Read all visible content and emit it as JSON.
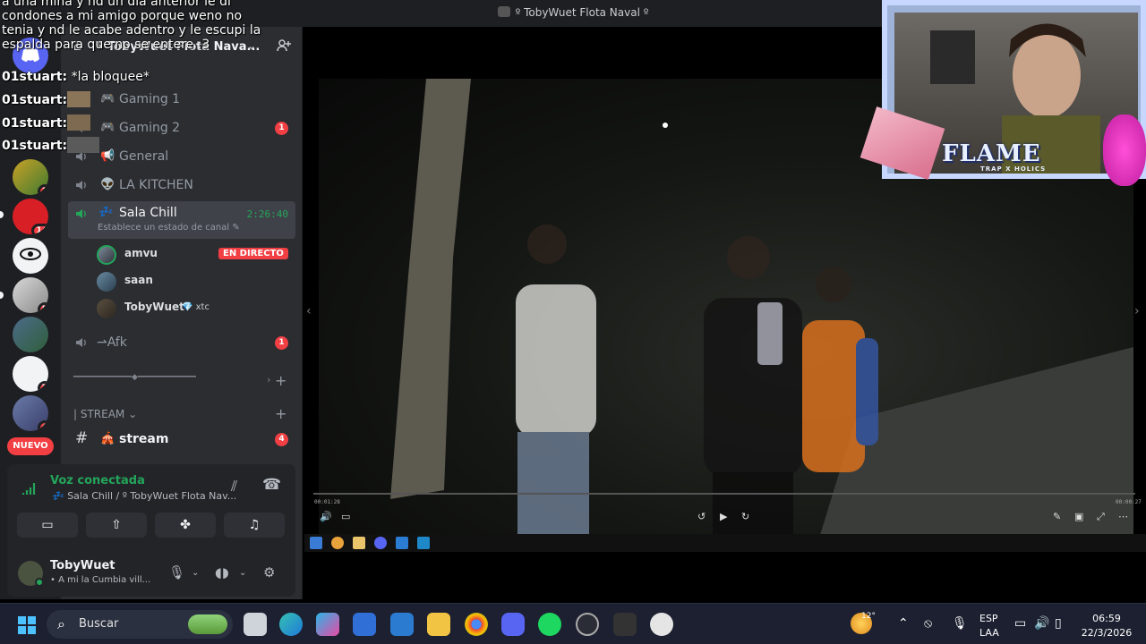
{
  "window": {
    "title": "º TobyWuet Flota Naval º"
  },
  "server": {
    "name": "º TobyWuet Flota Nava..."
  },
  "overlay_chat": {
    "paragraph": "a una mina y nd un dia anterior le di condones a mi amigo porque weno no tenia y nd le acabe adentro y le escupi la espalda para que no se entere :3",
    "lines": [
      {
        "user": "01stuart:",
        "text": " *la bloquee*"
      },
      {
        "user": "01stuart:",
        "text": ""
      },
      {
        "user": "01stuart:",
        "text": ""
      },
      {
        "user": "01stuart:",
        "text": ""
      }
    ]
  },
  "servers": [
    {
      "badge": ""
    },
    {
      "badge": "1"
    },
    {
      "badge": "14"
    },
    {
      "badge": ""
    },
    {
      "badge": "5"
    },
    {
      "badge": ""
    },
    {
      "badge": "7"
    },
    {
      "badge": "4"
    }
  ],
  "nuevo_label": "NUEVO",
  "channels": [
    {
      "emoji": "🎮",
      "label": "Gaming 1",
      "unread": ""
    },
    {
      "emoji": "🎮",
      "label": "Gaming 2",
      "unread": "1"
    },
    {
      "emoji": "📢",
      "label": "General",
      "unread": ""
    },
    {
      "emoji": "👽",
      "label": "LA KITCHEN",
      "unread": ""
    }
  ],
  "active_channel": {
    "emoji": "💤",
    "label": "Sala Chill",
    "timer": "2:26:40",
    "status": "Establece un estado de canal"
  },
  "members": [
    {
      "name": "amvu",
      "live": "EN DIRECTO",
      "tag": ""
    },
    {
      "name": "saan",
      "live": "",
      "tag": ""
    },
    {
      "name": "TobyWuet",
      "live": "",
      "tag": "💎 xtc"
    }
  ],
  "afk_channel": {
    "label": "⇀Afk",
    "unread": "1"
  },
  "divider": {
    "label": "━━━━━━━━━━━━◆━━━━━━━━━━━━"
  },
  "category": {
    "label": "| STREAM ⌄"
  },
  "stream_channel": {
    "emoji": "🎪",
    "label": "stream",
    "unread": "4"
  },
  "voice": {
    "title": "Voz conectada",
    "subtitle": "💤 Sala Chill / º TobyWuet Flota Nav..."
  },
  "user": {
    "name": "TobyWuet",
    "status": "• A mi la Cumbia vill..."
  },
  "video": {
    "time_start": "00:01:28",
    "time_end": "00:00:27"
  },
  "webcam": {
    "brand": "FLAME",
    "brand_sub": "TRAP X HOLICS"
  },
  "taskbar": {
    "search_placeholder": "Buscar",
    "weather_temp": "12°",
    "language": "ESP",
    "layout": "LAA",
    "time": "06:59",
    "date": "22/3/2026"
  }
}
